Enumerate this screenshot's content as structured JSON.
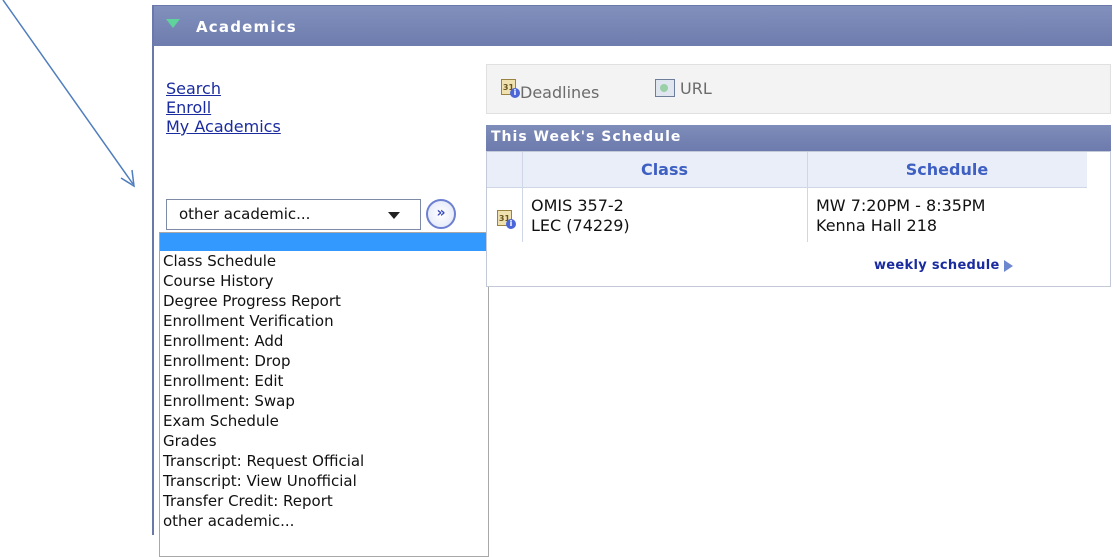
{
  "section": {
    "title": "Academics"
  },
  "links": [
    "Search",
    "Enroll",
    "My Academics"
  ],
  "dropdown": {
    "selected": "other academic...",
    "go_symbol": "»",
    "options": [
      "",
      "Class Schedule",
      "Course History",
      "Degree Progress Report",
      "Enrollment Verification",
      "Enrollment: Add",
      "Enrollment: Drop",
      "Enrollment: Edit",
      "Enrollment: Swap",
      "Exam Schedule",
      "Grades",
      "Transcript: Request Official",
      "Transcript: View Unofficial",
      "Transfer Credit: Report",
      "other academic..."
    ]
  },
  "toolbar": {
    "deadlines": "Deadlines",
    "url": "URL"
  },
  "schedule": {
    "title": "This Week's Schedule",
    "columns": [
      "Class",
      "Schedule"
    ],
    "row": {
      "class_line1": "OMIS 357-2",
      "class_line2": "LEC (74229)",
      "schedule_line1": "MW 7:20PM - 8:35PM",
      "schedule_line2": "Kenna Hall 218"
    },
    "weekly_link": "weekly schedule"
  },
  "icons": [
    "arrow-annotation",
    "expand-triangle-icon",
    "calendar-info-icon",
    "url-icon",
    "go-button-icon",
    "dropdown-caret-icon",
    "play-triangle-icon"
  ],
  "colors": {
    "header": "#6e7cae",
    "link": "#1a2ba0",
    "column_header_text": "#3f60c3",
    "highlight": "#3399ff"
  }
}
